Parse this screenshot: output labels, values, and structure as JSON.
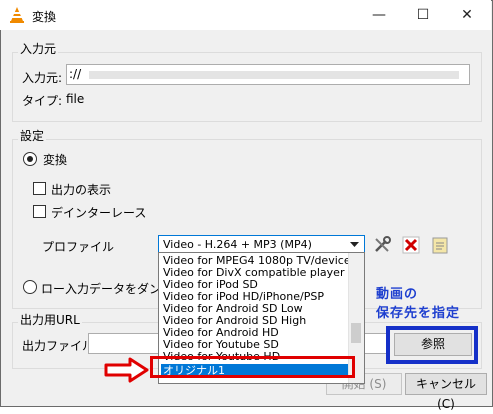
{
  "window": {
    "title": "変換",
    "minimize_glyph": "—",
    "maximize_glyph": "☐",
    "close_glyph": "✕"
  },
  "source": {
    "group_label": "入力元",
    "input_label": "入力元:",
    "input_value": "://",
    "type_label": "タイプ:",
    "type_value": "file"
  },
  "settings": {
    "group_label": "設定",
    "convert_label": "変換",
    "show_output_label": "出力の表示",
    "deinterlace_label": "デインターレース",
    "profile_label": "プロファイル",
    "profile_selected": "Video - H.264 + MP3 (MP4)",
    "raw_dump_label": "ロー入力データをダンプ",
    "profile_options": [
      "Video for MPEG4 1080p TV/device",
      "Video for DivX compatible player",
      "Video for iPod SD",
      "Video for iPod HD/iPhone/PSP",
      "Video for Android SD Low",
      "Video for Android SD High",
      "Video for Android HD",
      "Video for Youtube SD",
      "Video for Youtube HD",
      "オリジナル1"
    ]
  },
  "output": {
    "group_label": "出力用URL",
    "file_label": "出力ファイル:",
    "browse_label": "参照"
  },
  "footer": {
    "start_label": "開始 (S)",
    "cancel_label": "キャンセル (C)"
  },
  "annotation": {
    "line1": "動画の",
    "line2": "保存先を指定"
  },
  "colors": {
    "highlight": "#0078d7",
    "red_box": "#e00000",
    "blue_box": "#1530c8"
  }
}
